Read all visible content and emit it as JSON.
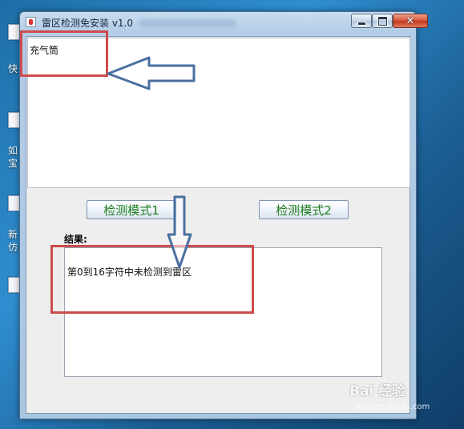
{
  "window": {
    "title": "雷区检测免安装 v1.0"
  },
  "editor": {
    "input_text": "充气筒"
  },
  "buttons": {
    "mode1_label": "检测模式1",
    "mode2_label": "检测模式2"
  },
  "result": {
    "label": "结果:",
    "text": "第0到16字符中未检测到雷区"
  },
  "desktop": {
    "labels": [
      "快",
      "如\n宝",
      "新\n仿"
    ]
  },
  "watermark": {
    "brand": "Bai 经验",
    "url": "jingyan.baidu.com"
  },
  "colors": {
    "annotation_red": "#cf4b4b",
    "arrow_blue": "#4a6fa0",
    "button_text_green": "#1f7e1f"
  }
}
